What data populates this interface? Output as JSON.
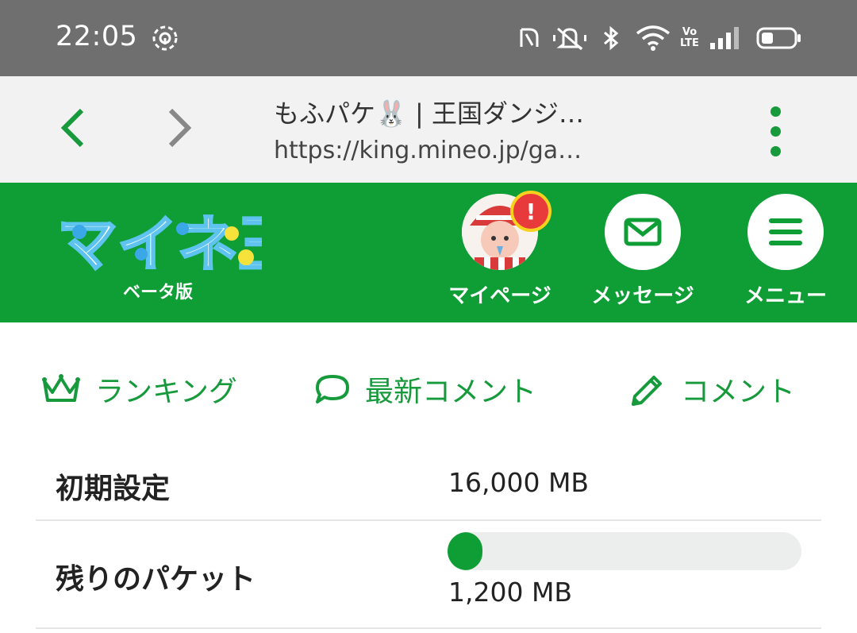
{
  "status_bar": {
    "time": "22:05",
    "icons": [
      "hotspot-icon",
      "nfc-icon",
      "mute-icon",
      "bluetooth-icon",
      "wifi-icon",
      "volte-icon",
      "signal-icon",
      "battery-icon"
    ],
    "volte_text": "Vo LTE"
  },
  "browser": {
    "title": "もふパケ🐰 | 王国ダンジ…",
    "url": "https://king.mineo.jp/ga…"
  },
  "app_header": {
    "logo_text": "マイネ王",
    "beta_label": "ベータ版",
    "mypage_label": "マイページ",
    "message_label": "メッセージ",
    "menu_label": "メニュー",
    "alert_badge": "!"
  },
  "tabs": {
    "ranking": "ランキング",
    "latest_comments": "最新コメント",
    "comment": "コメント"
  },
  "packet_table": {
    "initial_label": "初期設定",
    "initial_value": "16,000 MB",
    "remaining_label": "残りのパケット",
    "remaining_value": "1,200 MB",
    "remaining_fraction": 0.075
  },
  "colors": {
    "brand_green": "#0f9e36",
    "status_bar": "#6f6f6f",
    "alert_red": "#e83a3a"
  }
}
